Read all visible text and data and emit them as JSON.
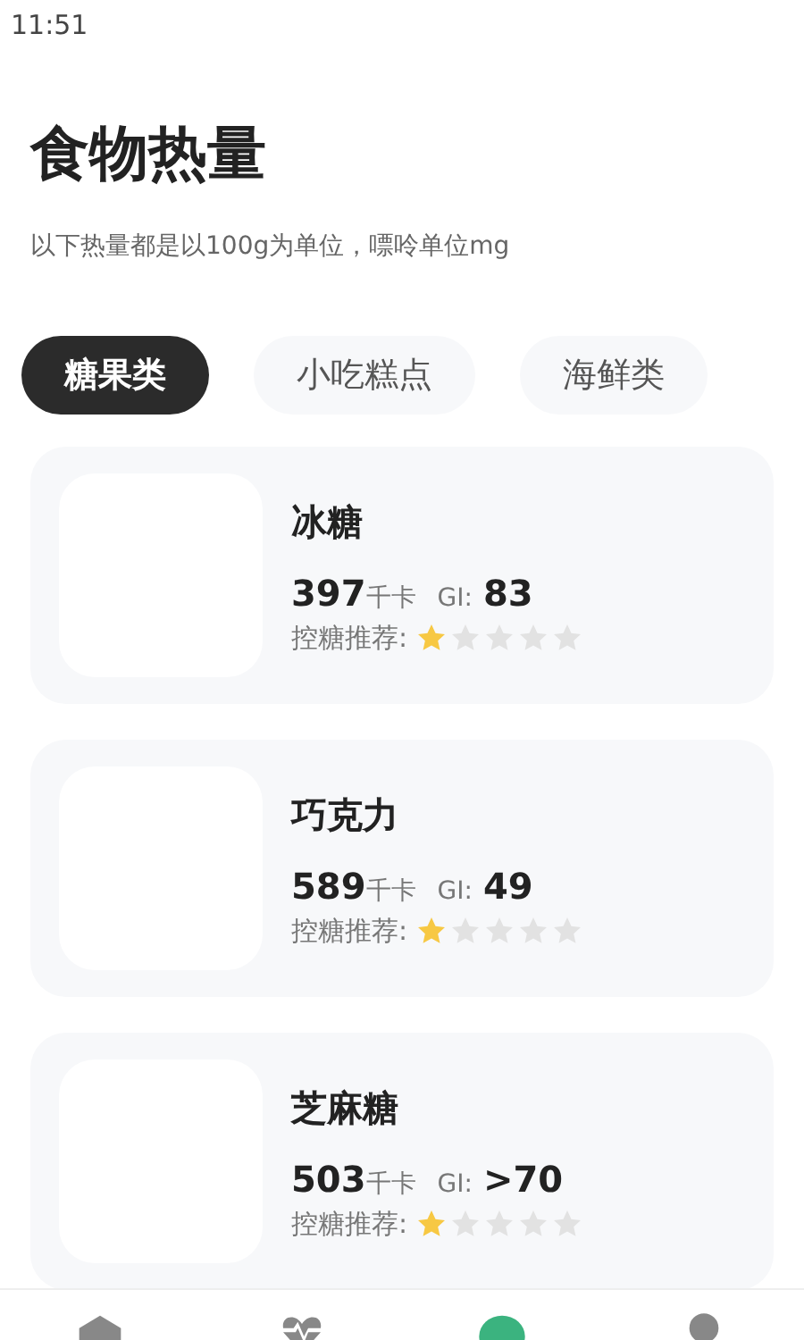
{
  "status_bar": {
    "time": "11:51"
  },
  "title": "食物热量",
  "subtitle": "以下热量都是以100g为单位，嘌呤单位mg",
  "tabs": [
    {
      "label": "糖果类",
      "selected": true
    },
    {
      "label": "小吃糕点",
      "selected": false
    },
    {
      "label": "海鲜类",
      "selected": false
    }
  ],
  "foods": [
    {
      "name": "冰糖",
      "calories": "397",
      "calorie_unit": "千卡",
      "gi_label": "GI:",
      "gi": "83",
      "recommend_label": "控糖推荐:",
      "stars": 1
    },
    {
      "name": "巧克力",
      "calories": "589",
      "calorie_unit": "千卡",
      "gi_label": "GI:",
      "gi": "49",
      "recommend_label": "控糖推荐:",
      "stars": 1
    },
    {
      "name": "芝麻糖",
      "calories": "503",
      "calorie_unit": "千卡",
      "gi_label": "GI:",
      "gi": ">70",
      "recommend_label": "控糖推荐:",
      "stars": 1
    }
  ],
  "nav": [
    {
      "kind": "home",
      "selected": false
    },
    {
      "kind": "health",
      "selected": false
    },
    {
      "kind": "food",
      "selected": true
    },
    {
      "kind": "profile",
      "selected": false
    }
  ]
}
